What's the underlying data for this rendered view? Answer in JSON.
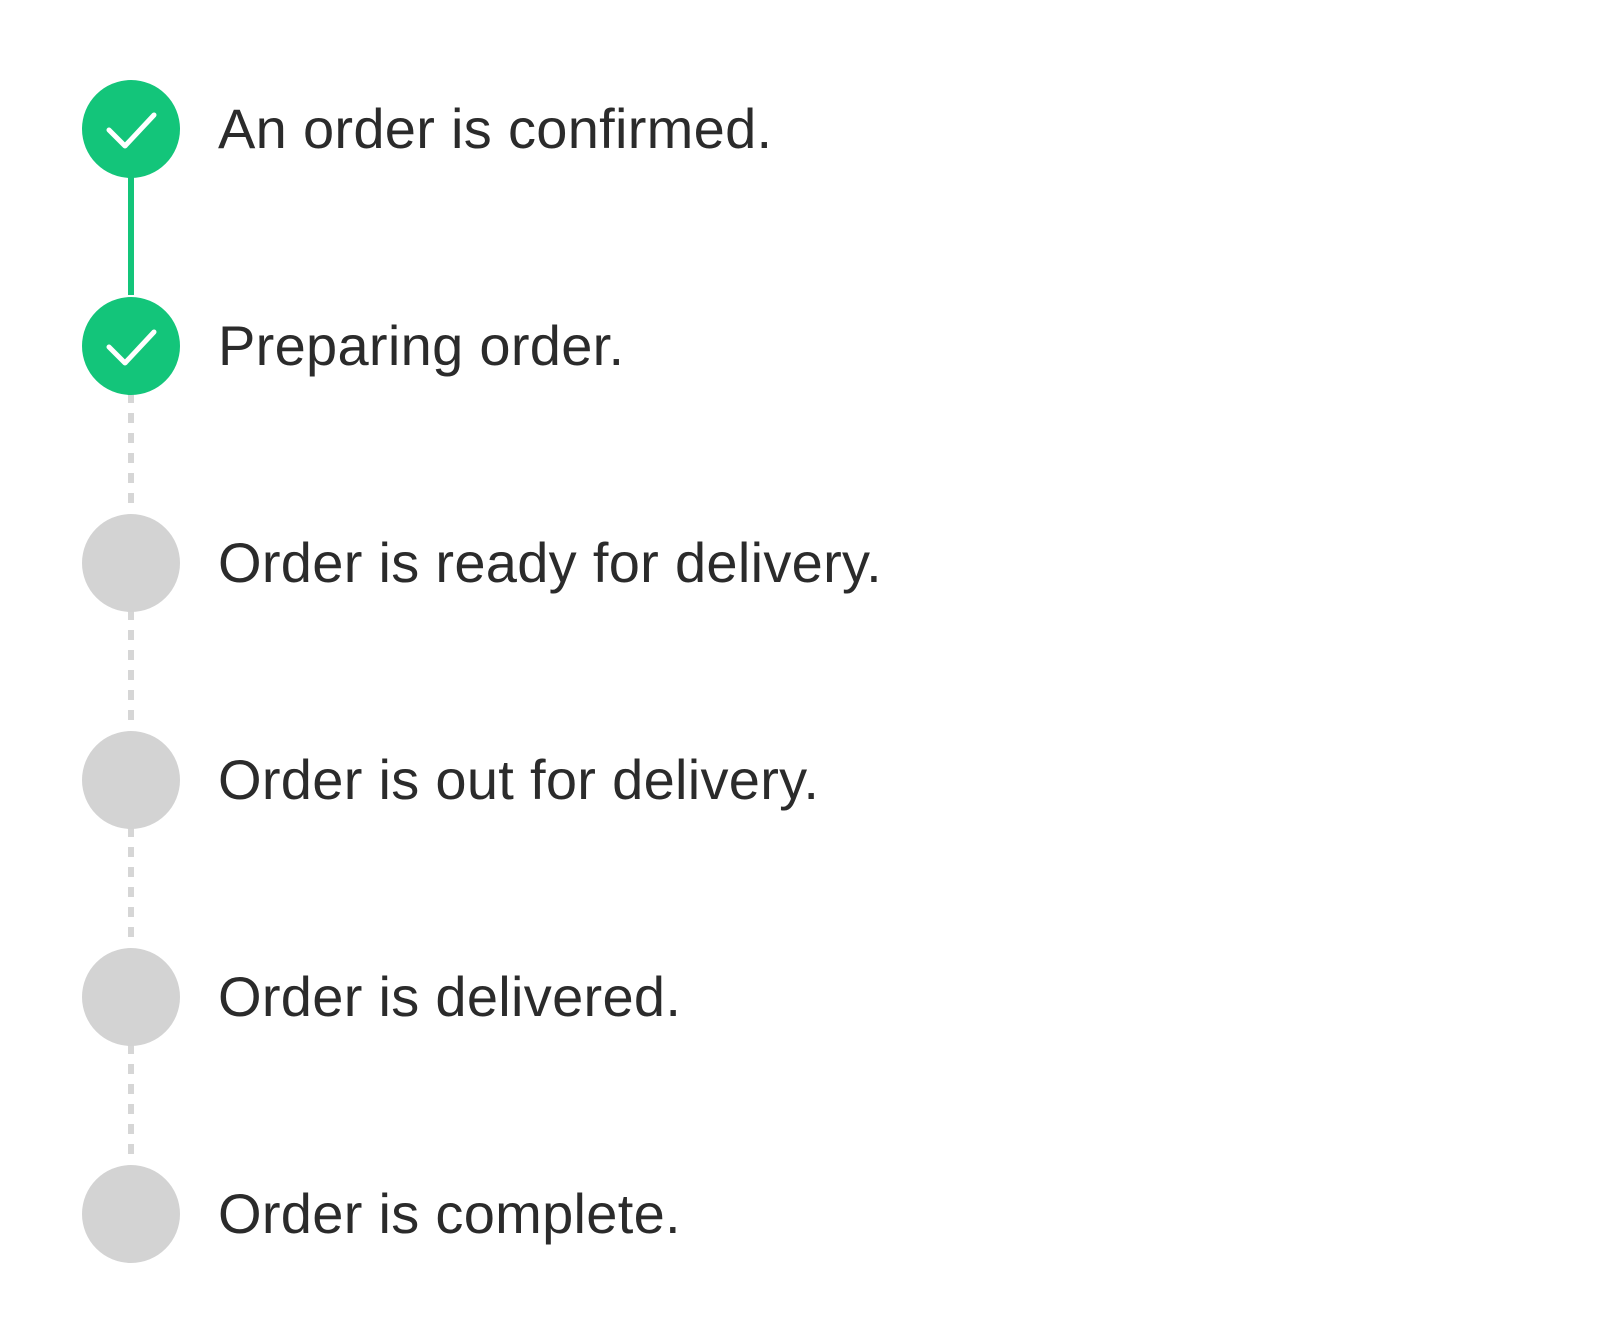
{
  "colors": {
    "complete": "#13c57a",
    "pending": "#d3d3d3",
    "text": "#2b2b2b"
  },
  "steps": [
    {
      "label": "An order is confirmed.",
      "status": "complete",
      "icon": "check-icon"
    },
    {
      "label": "Preparing order.",
      "status": "complete",
      "icon": "check-icon"
    },
    {
      "label": "Order is ready for delivery.",
      "status": "pending",
      "icon": ""
    },
    {
      "label": "Order is out for delivery.",
      "status": "pending",
      "icon": ""
    },
    {
      "label": "Order is delivered.",
      "status": "pending",
      "icon": ""
    },
    {
      "label": "Order is complete.",
      "status": "pending",
      "icon": ""
    }
  ]
}
